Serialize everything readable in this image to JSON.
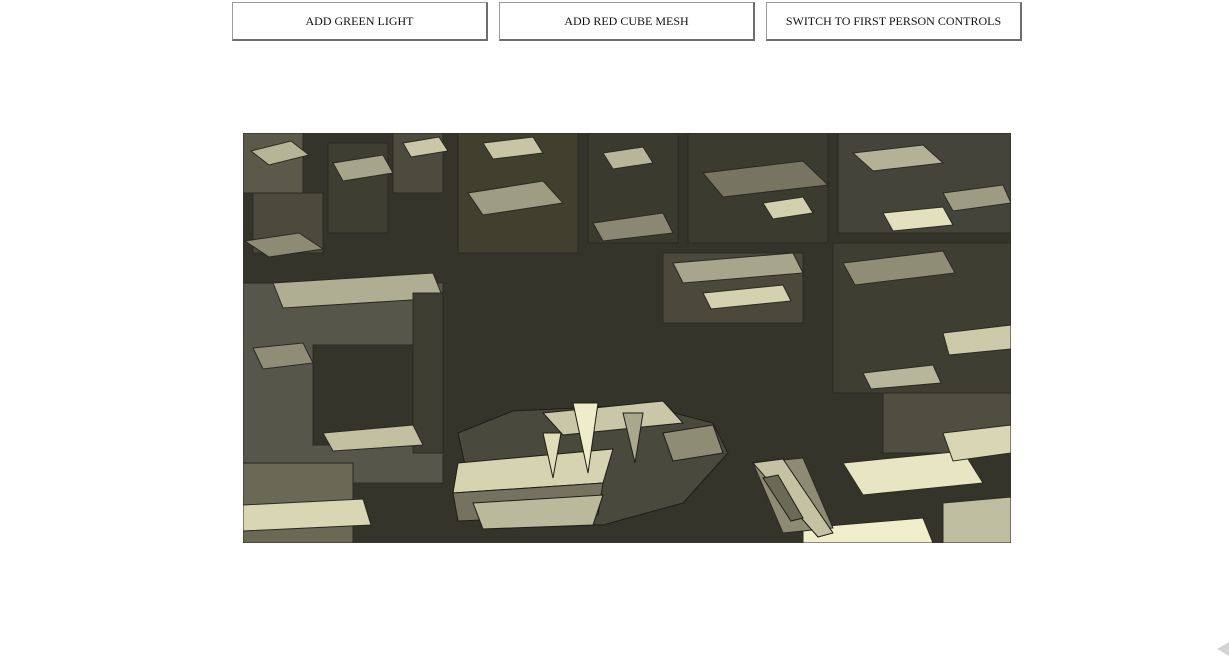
{
  "toolbar": {
    "buttons": [
      {
        "label": "ADD GREEN LIGHT"
      },
      {
        "label": "ADD RED CUBE MESH"
      },
      {
        "label": "SWITCH TO FIRST PERSON CONTROLS"
      }
    ]
  },
  "scene": {
    "background_color": "#35342b",
    "highlight_color": "#f4f1c6",
    "midtone_color": "#8a8872",
    "shadow_color": "#2a2a22"
  }
}
